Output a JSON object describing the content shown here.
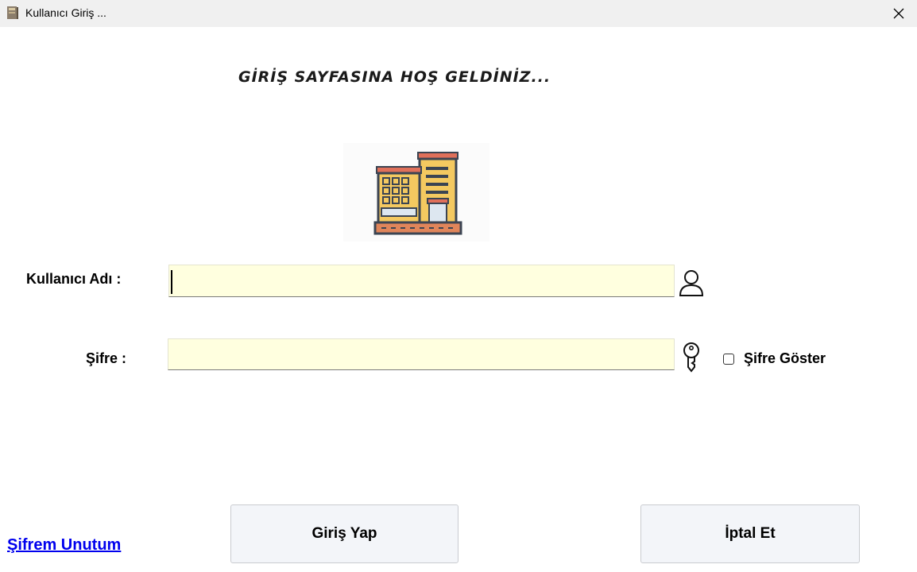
{
  "window": {
    "title": "Kullanıcı Giriş ...",
    "app_icon": "book-icon",
    "close_icon": "close-icon"
  },
  "main": {
    "welcome_text": "GİRİŞ SAYFASINA  HOŞ GELDİNİZ...",
    "logo_icon": "building-icon"
  },
  "form": {
    "username_label": "Kullanıcı Adı :",
    "username_value": "",
    "username_icon": "user-icon",
    "password_label": "Şifre  :",
    "password_value": "",
    "password_icon": "key-icon",
    "show_password_label": "Şifre Göster",
    "show_password_checked": false
  },
  "footer": {
    "forgot_link": "Şifrem Unutum",
    "login_button": "Giriş Yap",
    "cancel_button": "İptal Et"
  },
  "colors": {
    "input_background": "#ffffdf",
    "link": "#0000ee",
    "button_background": "#f3f5f9"
  }
}
